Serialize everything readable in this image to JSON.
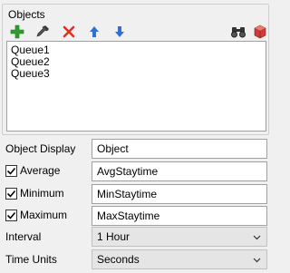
{
  "objects_group": {
    "title": "Objects",
    "toolbar": {
      "icons": [
        "add-icon",
        "eyedropper-icon",
        "delete-icon",
        "move-up-icon",
        "move-down-icon",
        "find-icon",
        "cube-icon"
      ]
    },
    "list": [
      "Queue1",
      "Queue2",
      "Queue3"
    ]
  },
  "object_display": {
    "label": "Object Display",
    "value": "Object"
  },
  "average": {
    "label": "Average",
    "checked": true,
    "value": "AvgStaytime"
  },
  "minimum": {
    "label": "Minimum",
    "checked": true,
    "value": "MinStaytime"
  },
  "maximum": {
    "label": "Maximum",
    "checked": true,
    "value": "MaxStaytime"
  },
  "interval": {
    "label": "Interval",
    "selected": "1 Hour"
  },
  "time_units": {
    "label": "Time Units",
    "selected": "Seconds"
  },
  "colors": {
    "add": "#2e9e2e",
    "delete": "#e03020",
    "arrow": "#2f6fd6",
    "cube": "#d23b3b"
  }
}
